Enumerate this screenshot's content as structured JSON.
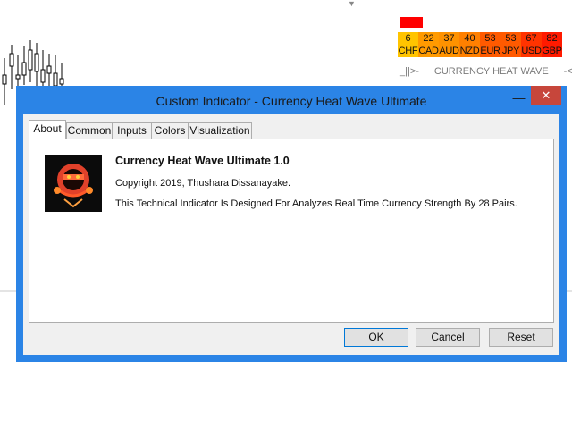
{
  "dialog": {
    "title": "Custom Indicator - Currency Heat Wave Ultimate",
    "minimize_glyph": "—",
    "close_glyph": "✕",
    "tabs": [
      {
        "label": "About",
        "active": true
      },
      {
        "label": "Common",
        "active": false
      },
      {
        "label": "Inputs",
        "active": false
      },
      {
        "label": "Colors",
        "active": false
      },
      {
        "label": "Visualization",
        "active": false
      }
    ],
    "about": {
      "name": "Currency Heat Wave Ultimate 1.0",
      "copyright": "Copyright 2019, Thushara Dissanayake.",
      "description": "This Technical Indicator Is Designed For Analyzes Real Time Currency Strength By 28 Pairs."
    },
    "buttons": {
      "ok": "OK",
      "cancel": "Cancel",
      "reset": "Reset"
    }
  },
  "heatmap": {
    "cells": [
      {
        "value": "6",
        "currency": "CHF",
        "color": "#ffc400"
      },
      {
        "value": "22",
        "currency": "CAD",
        "color": "#ff9a00"
      },
      {
        "value": "37",
        "currency": "AUD",
        "color": "#ff9200"
      },
      {
        "value": "40",
        "currency": "NZD",
        "color": "#ff8000"
      },
      {
        "value": "53",
        "currency": "EUR",
        "color": "#ff5a00"
      },
      {
        "value": "53",
        "currency": "JPY",
        "color": "#ff5a00"
      },
      {
        "value": "67",
        "currency": "USD",
        "color": "#ff3300"
      },
      {
        "value": "82",
        "currency": "GBP",
        "color": "#ff1a00"
      }
    ],
    "label_left": "_||>-",
    "label_mid": "CURRENCY HEAT WAVE",
    "label_right": "-<||_",
    "top_swatch_color": "#ff0000"
  },
  "chart": {
    "dropdown_glyph": "▼"
  }
}
